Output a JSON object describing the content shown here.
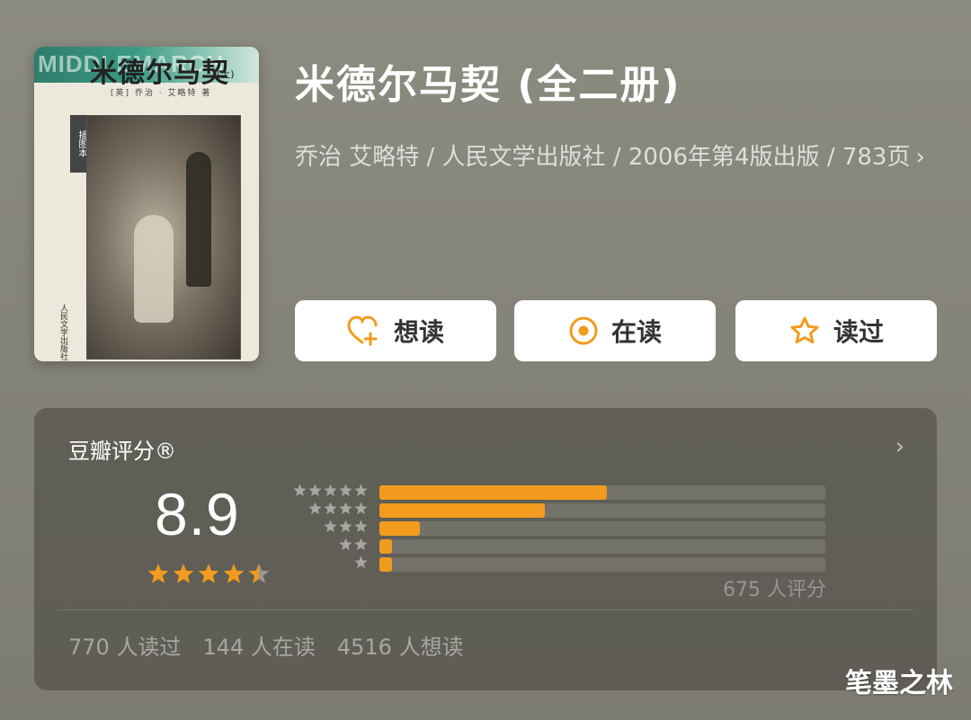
{
  "cover": {
    "title_art": "米德尔马契",
    "big_latin": "MIDDLEMARCH",
    "volume": "(上)",
    "authors": "[英] 乔治 · 艾略特 著",
    "stamp": "插图本",
    "publisher": "人民文学出版社"
  },
  "book": {
    "title": "米德尔马契 (全二册)",
    "meta": "乔治 艾略特 / 人民文学出版社 / 2006年第4版出版 / 783页"
  },
  "actions": {
    "want": "想读",
    "reading": "在读",
    "read": "读过"
  },
  "rating": {
    "header": "豆瓣评分®",
    "score": "8.9",
    "stars": 4.5,
    "distribution": [
      {
        "stars": 5,
        "fraction": 0.51
      },
      {
        "stars": 4,
        "fraction": 0.37
      },
      {
        "stars": 3,
        "fraction": 0.09
      },
      {
        "stars": 2,
        "fraction": 0.02
      },
      {
        "stars": 1,
        "fraction": 0.02
      }
    ],
    "count": "675 人评分"
  },
  "stats": {
    "read": "770 人读过",
    "reading": "144 人在读",
    "want": "4516 人想读"
  },
  "watermark": "笔墨之林",
  "colors": {
    "accent": "#f29b1e",
    "background": "#86857b",
    "card": "#5e5c54"
  }
}
